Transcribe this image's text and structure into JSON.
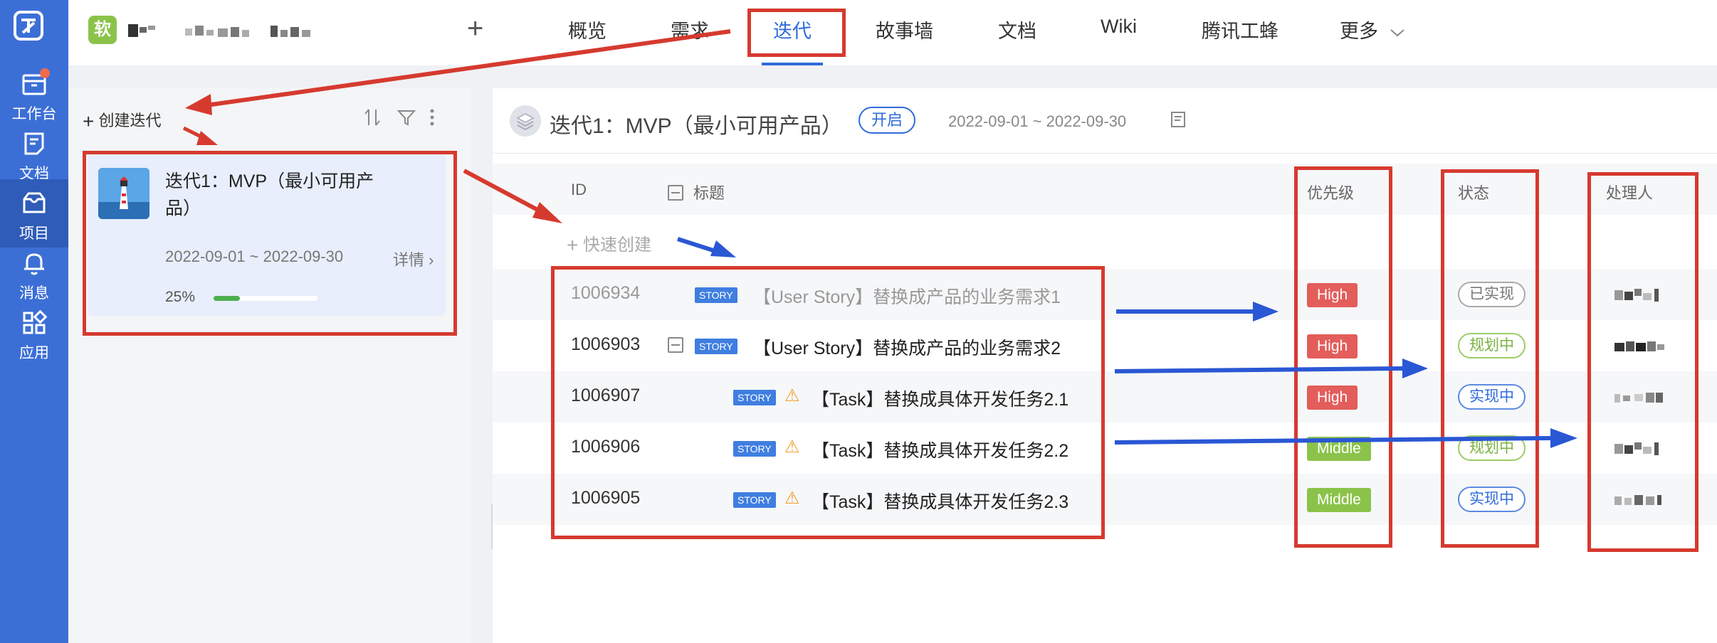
{
  "leftbar": {
    "items": [
      {
        "label": "工作台",
        "icon": "inbox-icon"
      },
      {
        "label": "文档",
        "icon": "document-icon"
      },
      {
        "label": "项目",
        "icon": "project-box-icon"
      },
      {
        "label": "消息",
        "icon": "bell-icon"
      },
      {
        "label": "应用",
        "icon": "apps-grid-icon"
      }
    ]
  },
  "topbar": {
    "app_icon_text": "软",
    "tabs": [
      "概览",
      "需求",
      "迭代",
      "故事墙",
      "文档",
      "Wiki",
      "腾讯工蜂",
      "更多"
    ],
    "active_tab": "迭代"
  },
  "left_panel": {
    "create_label": "创建迭代",
    "iteration": {
      "name": "迭代1：MVP（最小可用产品）",
      "date": "2022-09-01 ~ 2022-09-30",
      "detail_label": "详情",
      "progress_label": "25%",
      "progress": 0.25
    }
  },
  "main": {
    "header": {
      "title": "迭代1：MVP（最小可用产品）",
      "status": "开启",
      "date": "2022-09-01 ~ 2022-09-30"
    },
    "columns": {
      "id": "ID",
      "title": "标题",
      "priority": "优先级",
      "status": "状态",
      "assignee": "处理人"
    },
    "quick_create": "快速创建",
    "rows": [
      {
        "id": "1006934",
        "tag": "STORY",
        "title": "【User Story】替换成产品的业务需求1",
        "priority": "High",
        "status": "已实现"
      },
      {
        "id": "1006903",
        "tag": "STORY",
        "title": "【User Story】替换成产品的业务需求2",
        "priority": "High",
        "status": "规划中"
      },
      {
        "id": "1006907",
        "tag": "STORY",
        "title": "【Task】替换成具体开发任务2.1",
        "priority": "High",
        "status": "实现中"
      },
      {
        "id": "1006906",
        "tag": "STORY",
        "title": "【Task】替换成具体开发任务2.2",
        "priority": "Middle",
        "status": "规划中"
      },
      {
        "id": "1006905",
        "tag": "STORY",
        "title": "【Task】替换成具体开发任务2.3",
        "priority": "Middle",
        "status": "实现中"
      }
    ]
  },
  "colors": {
    "sidebar": "#3c6fd6",
    "accent": "#2f6bd9",
    "high": "#e35d5b",
    "middle": "#8bc34a",
    "annotation_red": "#d63a2f",
    "annotation_blue": "#2a57d4"
  }
}
